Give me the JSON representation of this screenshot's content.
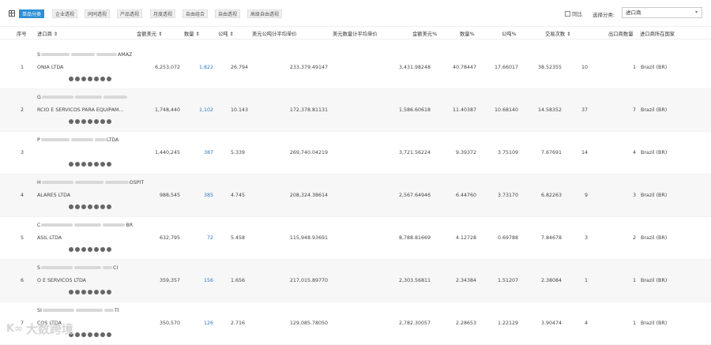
{
  "toolbar": {
    "tabs": [
      "单品分类",
      "企业透视",
      "同同透视",
      "产品透视",
      "月度透视",
      "自由组合",
      "自由透视",
      "高级自由透视"
    ],
    "compare_label": "同比",
    "select_label": "选择分类:",
    "select_value": "进口商"
  },
  "table": {
    "headers": [
      "序号",
      "进口商 ⇕",
      "金额美元 ⇕",
      "数量 ⇕",
      "公吨 ⇕",
      "美元公吨计平均单价",
      "美元数量计平均单价",
      "金额美元%",
      "数量%",
      "公吨%",
      "交易次数 ⇕",
      "出口商数量",
      "进口商所在国家"
    ],
    "rows": [
      {
        "idx": "1",
        "name1": "S",
        "name1_tail": "AMAZ",
        "name2": "ONIA LTDA",
        "amount": "6,253,072",
        "qty": "1,822",
        "tons": "26.794",
        "usd_per_ton": "233,379.49147",
        "usd_per_qty": "3,431.98248",
        "amount_pct": "40.78447",
        "qty_pct": "17.66017",
        "tons_pct": "38.52355",
        "trades": "10",
        "exporters": "1",
        "country": "Brazil (BR)"
      },
      {
        "idx": "2",
        "name1": "G",
        "name1_tail": "",
        "name2": "RCIO E SERVICOS PARA EQUIPAM...",
        "amount": "1,748,440",
        "qty": "1,102",
        "tons": "10.143",
        "usd_per_ton": "172,378.81131",
        "usd_per_qty": "1,586.60618",
        "amount_pct": "11.40387",
        "qty_pct": "10.68140",
        "tons_pct": "14.58352",
        "trades": "37",
        "exporters": "7",
        "country": "Brazil (BR)"
      },
      {
        "idx": "3",
        "name1": "P",
        "name1_tail": "LTDA",
        "name2": "",
        "amount": "1,440,245",
        "qty": "387",
        "tons": "5.339",
        "usd_per_ton": "269,740.04219",
        "usd_per_qty": "3,721.56224",
        "amount_pct": "9.39372",
        "qty_pct": "3.75109",
        "tons_pct": "7.67691",
        "trades": "14",
        "exporters": "4",
        "country": "Brazil (BR)"
      },
      {
        "idx": "4",
        "name1": "H",
        "name1_tail": "OSPIT",
        "name2": "ALARES LTDA",
        "amount": "988,545",
        "qty": "385",
        "tons": "4.745",
        "usd_per_ton": "208,324.38614",
        "usd_per_qty": "2,567.64946",
        "amount_pct": "6.44760",
        "qty_pct": "3.73170",
        "tons_pct": "6.82263",
        "trades": "9",
        "exporters": "3",
        "country": "Brazil (BR)"
      },
      {
        "idx": "5",
        "name1": "C",
        "name1_tail": "BR",
        "name2": "ASIL LTDA",
        "amount": "632,795",
        "qty": "72",
        "tons": "5.458",
        "usd_per_ton": "115,948.93691",
        "usd_per_qty": "8,788.81669",
        "amount_pct": "4.12728",
        "qty_pct": "0.69788",
        "tons_pct": "7.84678",
        "trades": "3",
        "exporters": "2",
        "country": "Brazil (BR)"
      },
      {
        "idx": "6",
        "name1": "S",
        "name1_tail": "CI",
        "name2": "O E SERVICOS LTDA",
        "amount": "359,357",
        "qty": "156",
        "tons": "1.656",
        "usd_per_ton": "217,015.89770",
        "usd_per_qty": "2,303.56811",
        "amount_pct": "2.34384",
        "qty_pct": "1.51207",
        "tons_pct": "2.38084",
        "trades": "1",
        "exporters": "1",
        "country": "Brazil (BR)"
      },
      {
        "idx": "7",
        "name1": "SI",
        "name1_tail": "TI",
        "name2": "COS LTDA",
        "amount": "350,570",
        "qty": "126",
        "tons": "2.716",
        "usd_per_ton": "129,085.78050",
        "usd_per_qty": "2,782.30057",
        "amount_pct": "2.28653",
        "qty_pct": "1.22129",
        "tons_pct": "3.90474",
        "trades": "4",
        "exporters": "1",
        "country": "Brazil (BR)"
      }
    ]
  },
  "row_icons": [
    "shield-icon",
    "user-icon",
    "phone-icon",
    "mail-icon",
    "globe-icon",
    "people-icon",
    "gear-icon"
  ],
  "watermark": "大数跨境"
}
